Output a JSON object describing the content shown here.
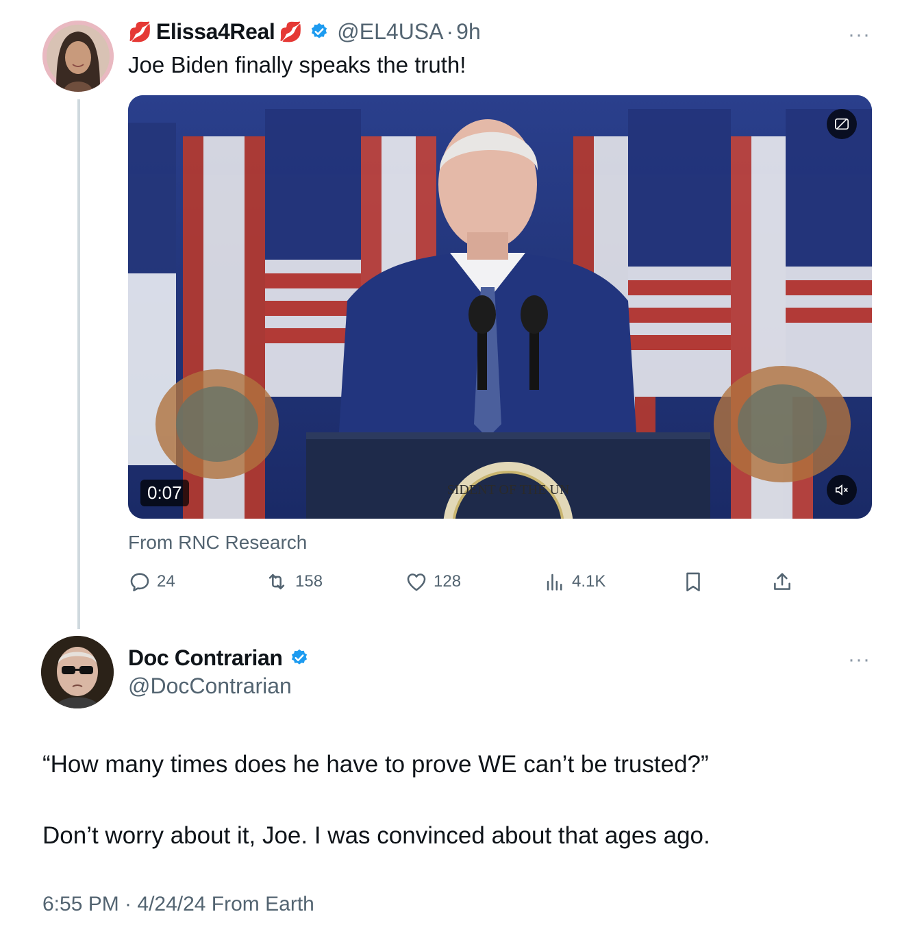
{
  "first_tweet": {
    "emoji_left": "💋",
    "display_name": "Elissa4Real",
    "emoji_right": "💋",
    "handle": "@EL4USA",
    "separator": "·",
    "age": "9h",
    "text": "Joe Biden finally speaks the truth!",
    "video": {
      "duration": "0:07",
      "seal_text": "SIDENT OF THE UN"
    },
    "source": "From RNC Research",
    "metrics": {
      "replies": "24",
      "retweets": "158",
      "likes": "128",
      "views": "4.1K"
    },
    "more_label": "···"
  },
  "second_tweet": {
    "display_name": "Doc Contrarian",
    "handle": "@DocContrarian",
    "more_label": "···",
    "paragraph_1": "“How many times does he have to prove WE can’t be trusted?”",
    "paragraph_2": "Don’t worry about it, Joe. I was convinced about that ages ago.",
    "timestamp": "6:55 PM · 4/24/24 From Earth"
  },
  "colors": {
    "verified_blue": "#1d9bf0",
    "secondary_text": "#536471",
    "thread_line": "#cfd9de",
    "lips_red": "#e0245e"
  },
  "icons": [
    "lips-icon",
    "verified-badge-icon",
    "more-icon",
    "reply-icon",
    "retweet-icon",
    "like-icon",
    "views-icon",
    "bookmark-icon",
    "share-icon",
    "captions-icon",
    "mute-icon"
  ]
}
